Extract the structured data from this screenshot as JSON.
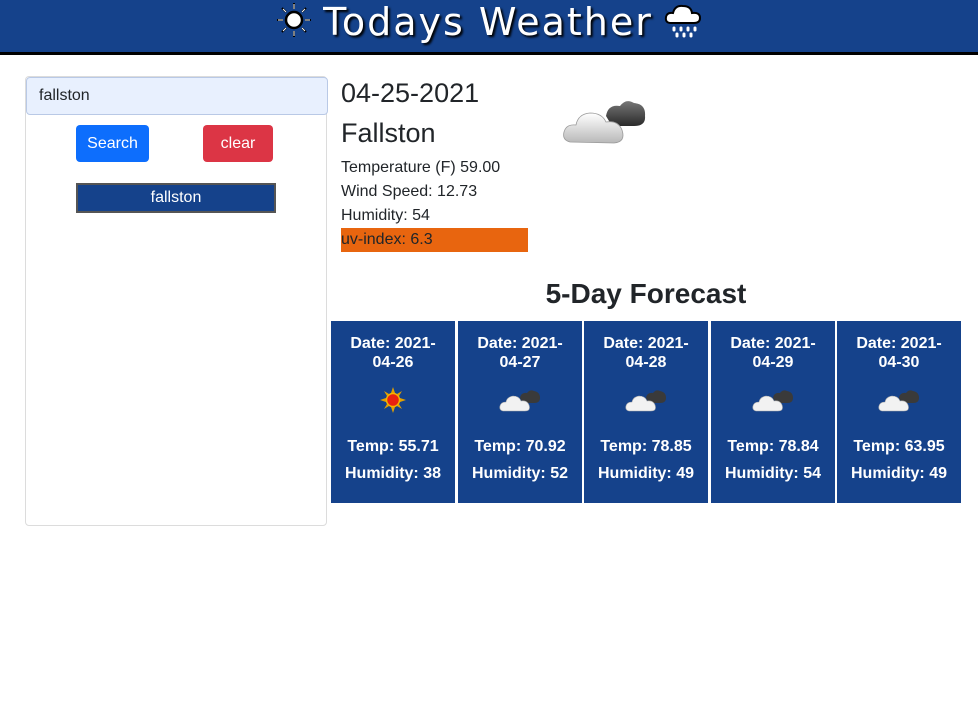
{
  "header": {
    "title": "Todays Weather",
    "left_icon": "sun-icon",
    "right_icon": "rain-cloud-icon"
  },
  "search": {
    "value": "fallston",
    "search_label": "Search",
    "clear_label": "clear",
    "history": [
      "fallston"
    ]
  },
  "current": {
    "date": "04-25-2021",
    "city": "Fallston",
    "temperature": "Temperature (F) 59.00",
    "wind": "Wind Speed: 12.73",
    "humidity": "Humidity: 54",
    "uv": "uv-index: 6.3",
    "icon": "cloud-icon"
  },
  "forecast": {
    "title": "5-Day Forecast",
    "days": [
      {
        "date": "Date: 2021-04-26",
        "icon": "sun-icon",
        "temp": "Temp: 55.71",
        "humidity": "Humidity: 38"
      },
      {
        "date": "Date: 2021-04-27",
        "icon": "cloud-icon",
        "temp": "Temp: 70.92",
        "humidity": "Humidity: 52"
      },
      {
        "date": "Date: 2021-04-28",
        "icon": "cloud-icon",
        "temp": "Temp: 78.85",
        "humidity": "Humidity: 49"
      },
      {
        "date": "Date: 2021-04-29",
        "icon": "cloud-icon",
        "temp": "Temp: 78.84",
        "humidity": "Humidity: 54"
      },
      {
        "date": "Date: 2021-04-30",
        "icon": "cloud-icon",
        "temp": "Temp: 63.95",
        "humidity": "Humidity: 49"
      }
    ]
  },
  "colors": {
    "brand_blue": "#15428b",
    "search_button": "#0d6efd",
    "clear_button": "#dc3545",
    "uv_badge": "#e8650f"
  }
}
